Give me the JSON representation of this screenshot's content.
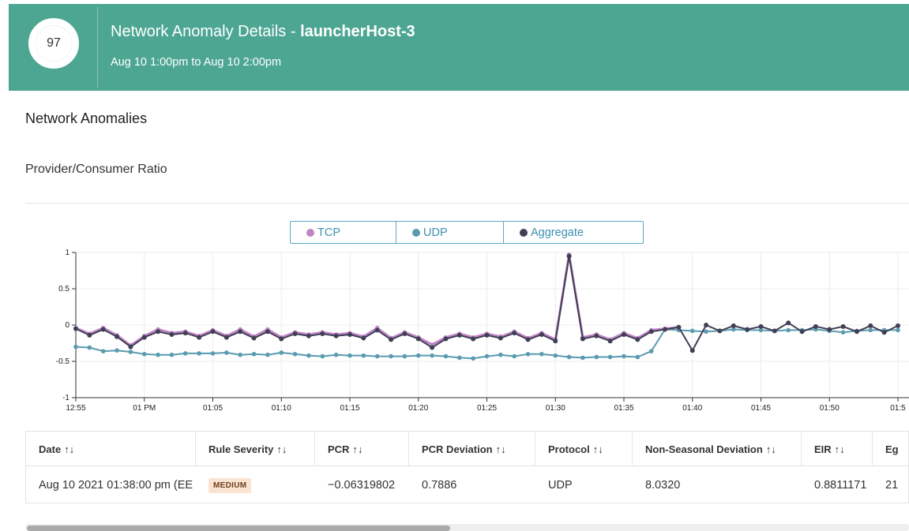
{
  "header": {
    "score": "97",
    "title_prefix": "Network Anomaly Details - ",
    "host": "launcherHost-3",
    "subtitle": "Aug 10 1:00pm to Aug 10 2:00pm",
    "background_color": "#4da692"
  },
  "section_title": "Network Anomalies",
  "subsection_title": "Provider/Consumer Ratio",
  "legend": [
    {
      "label": "TCP",
      "color": "#c084c4"
    },
    {
      "label": "UDP",
      "color": "#5a9bb0"
    },
    {
      "label": "Aggregate",
      "color": "#3f3f55"
    }
  ],
  "chart_data": {
    "type": "line",
    "ylim": [
      -1,
      1
    ],
    "yticks": [
      "1",
      "0.5",
      "0",
      "-0.5",
      "-1"
    ],
    "xticks": [
      "12:55",
      "01 PM",
      "01:05",
      "01:10",
      "01:15",
      "01:20",
      "01:25",
      "01:30",
      "01:35",
      "01:40",
      "01:45",
      "01:50",
      "01:5"
    ],
    "x_minutes_start": 0,
    "x_minutes_step": 1,
    "series": [
      {
        "name": "TCP",
        "color": "#c084c4",
        "values": [
          -0.04,
          -0.12,
          -0.04,
          -0.14,
          -0.28,
          -0.15,
          -0.06,
          -0.11,
          -0.09,
          -0.15,
          -0.07,
          -0.15,
          -0.06,
          -0.16,
          -0.06,
          -0.17,
          -0.1,
          -0.13,
          -0.1,
          -0.13,
          -0.11,
          -0.16,
          -0.04,
          -0.18,
          -0.1,
          -0.17,
          -0.27,
          -0.17,
          -0.12,
          -0.17,
          -0.12,
          -0.16,
          -0.09,
          -0.18,
          -0.11,
          -0.2,
          0.97,
          -0.17,
          -0.13,
          -0.2,
          -0.11,
          -0.18,
          -0.07,
          -0.05,
          -0.03,
          null,
          null,
          null,
          null,
          null,
          null,
          null,
          null,
          null,
          null,
          null,
          null,
          null,
          null,
          null,
          null
        ]
      },
      {
        "name": "UDP",
        "color": "#5a9bb0",
        "values": [
          -0.3,
          -0.31,
          -0.36,
          -0.35,
          -0.37,
          -0.4,
          -0.41,
          -0.41,
          -0.39,
          -0.39,
          -0.39,
          -0.38,
          -0.41,
          -0.4,
          -0.41,
          -0.38,
          -0.4,
          -0.42,
          -0.43,
          -0.41,
          -0.42,
          -0.42,
          -0.43,
          -0.43,
          -0.43,
          -0.42,
          -0.42,
          -0.43,
          -0.45,
          -0.46,
          -0.43,
          -0.41,
          -0.43,
          -0.4,
          -0.4,
          -0.42,
          -0.44,
          -0.45,
          -0.44,
          -0.44,
          -0.43,
          -0.44,
          -0.36,
          -0.06,
          -0.07,
          -0.08,
          -0.09,
          -0.08,
          -0.06,
          -0.07,
          -0.07,
          -0.08,
          -0.07,
          -0.07,
          -0.06,
          -0.08,
          -0.1,
          -0.08,
          -0.07,
          -0.07,
          -0.07
        ]
      },
      {
        "name": "Aggregate",
        "color": "#3f3f55",
        "values": [
          -0.05,
          -0.14,
          -0.06,
          -0.16,
          -0.3,
          -0.17,
          -0.09,
          -0.13,
          -0.11,
          -0.17,
          -0.09,
          -0.17,
          -0.09,
          -0.18,
          -0.09,
          -0.19,
          -0.12,
          -0.15,
          -0.12,
          -0.15,
          -0.13,
          -0.18,
          -0.07,
          -0.2,
          -0.12,
          -0.19,
          -0.31,
          -0.19,
          -0.14,
          -0.19,
          -0.14,
          -0.18,
          -0.11,
          -0.2,
          -0.13,
          -0.22,
          0.95,
          -0.19,
          -0.15,
          -0.22,
          -0.13,
          -0.2,
          -0.09,
          -0.06,
          -0.03,
          -0.35,
          0.0,
          -0.08,
          -0.01,
          -0.06,
          -0.02,
          -0.08,
          0.03,
          -0.09,
          -0.02,
          -0.06,
          -0.02,
          -0.09,
          -0.01,
          -0.1,
          -0.01
        ]
      }
    ]
  },
  "table": {
    "sort_icon": "↑↓",
    "headers": [
      "Date",
      "Rule Severity",
      "PCR",
      "PCR Deviation",
      "Protocol",
      "Non-Seasonal Deviation",
      "EIR",
      "Eg"
    ],
    "row": {
      "date": "Aug 10 2021 01:38:00 pm (EE",
      "severity": "MEDIUM",
      "pcr": "−0.06319802",
      "pcr_deviation": "0.7886",
      "protocol": "UDP",
      "non_seasonal_deviation": "8.0320",
      "eir": "0.8811171",
      "eg": "21"
    }
  }
}
